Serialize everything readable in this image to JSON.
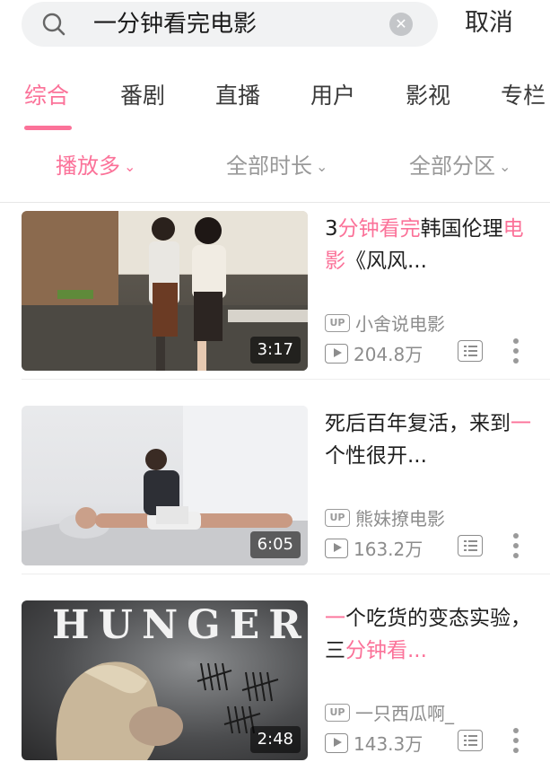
{
  "search": {
    "query": "一分钟看完电影",
    "clear_symbol": "✕",
    "cancel_label": "取消"
  },
  "tabs": [
    {
      "label": "综合",
      "active": true
    },
    {
      "label": "番剧",
      "active": false
    },
    {
      "label": "直播",
      "active": false
    },
    {
      "label": "用户",
      "active": false
    },
    {
      "label": "影视",
      "active": false
    },
    {
      "label": "专栏",
      "active": false
    }
  ],
  "filters": [
    {
      "label": "播放多",
      "active": true
    },
    {
      "label": "全部时长",
      "active": false
    },
    {
      "label": "全部分区",
      "active": false
    }
  ],
  "filter_caret": "⌄",
  "accent_color": "#fb7299",
  "videos": [
    {
      "title_parts": [
        {
          "text": "3",
          "hl": false
        },
        {
          "text": "分钟看完",
          "hl": true
        },
        {
          "text": "韩国伦理",
          "hl": false
        },
        {
          "text": "电影",
          "hl": true
        },
        {
          "text": "《风风...",
          "hl": false
        }
      ],
      "duration": "3:17",
      "up_badge": "UP",
      "uploader": "小舍说电影",
      "views": "204.8万",
      "thumbnail_icon": "kitchen-scene"
    },
    {
      "title_parts": [
        {
          "text": "死后百年复活，来到",
          "hl": false
        },
        {
          "text": "一",
          "hl": true
        },
        {
          "text": "个性很开...",
          "hl": false
        }
      ],
      "duration": "6:05",
      "up_badge": "UP",
      "uploader": "熊妹撩电影",
      "views": "163.2万",
      "thumbnail_icon": "lab-scene"
    },
    {
      "title_parts": [
        {
          "text": "一",
          "hl": true
        },
        {
          "text": "个吃货的变态实验，三",
          "hl": false
        },
        {
          "text": "分钟看",
          "hl": true
        },
        {
          "text": "...",
          "hl": false
        }
      ],
      "duration": "2:48",
      "up_badge": "UP",
      "uploader": "一只西瓜啊_",
      "views": "143.3万",
      "thumbnail_icon": "poster-scene",
      "poster_text": "HUNGER"
    }
  ]
}
